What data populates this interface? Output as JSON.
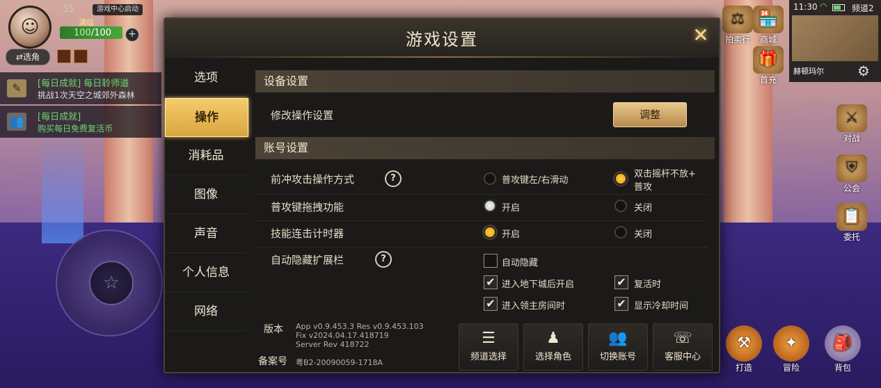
{
  "hud": {
    "level": "55",
    "banner": "游戏中心启动",
    "rank": "满级",
    "stamina_current": "100",
    "stamina_max": "/100",
    "stamina_fraction": 1.0,
    "plus": "+",
    "switch_role": "⇄选角",
    "quests": [
      {
        "title": "[每日成就] 每日聆师道",
        "desc": "挑战1次天空之城郊外森林"
      },
      {
        "title": "[每日成就]",
        "desc": "购买每日免费复活币"
      }
    ]
  },
  "status": {
    "time": "11:30",
    "channel": "频道2",
    "map_name": "赫顿玛尔"
  },
  "right_icons": [
    {
      "label": "拍卖行",
      "icon": "auction-icon"
    },
    {
      "label": "商城",
      "icon": "shop-icon"
    },
    {
      "label": "首充",
      "icon": "first-charge-icon"
    },
    {
      "label": "对战",
      "icon": "battle-icon"
    },
    {
      "label": "公会",
      "icon": "guild-icon"
    },
    {
      "label": "委托",
      "icon": "commission-icon"
    }
  ],
  "bottom_actions": [
    {
      "label": "打造",
      "icon": "forge-icon"
    },
    {
      "label": "冒险",
      "icon": "adventure-icon"
    },
    {
      "label": "背包",
      "icon": "bag-icon"
    }
  ],
  "dialog": {
    "title": "游戏设置",
    "nav": [
      "选项",
      "操作",
      "消耗品",
      "图像",
      "声音",
      "个人信息",
      "网络"
    ],
    "active_nav": "操作",
    "device_section": "设备设置",
    "modify_label": "修改操作设置",
    "adjust_button": "调整",
    "account_section": "账号设置",
    "rows": {
      "dash_attack": {
        "label": "前冲攻击操作方式",
        "opt1": "普攻键左/右滑动",
        "opt2_line1": "双击摇杆不放+",
        "opt2_line2": "普攻"
      },
      "drag": {
        "label": "普攻键拖拽功能",
        "opt1": "开启",
        "opt2": "关闭"
      },
      "combo_timer": {
        "label": "技能连击计时器",
        "opt1": "开启",
        "opt2": "关闭"
      },
      "auto_hide": {
        "label": "自动隐藏扩展栏",
        "opt_auto": "自动隐藏",
        "opt_dungeon": "进入地下城后开启",
        "opt_revive": "复活时",
        "opt_boss": "进入领主房间时",
        "opt_cooldown": "显示冷却时间"
      }
    },
    "footer": {
      "version_label": "版本",
      "version_line1": "App v0.9.453.3 Res v0.9.453.103",
      "version_line2": "Fix v2024.04.17.418719",
      "version_line3": "Server Rev 418722",
      "record_label": "备案号",
      "record_value": "粤B2-20090059-1718A",
      "buttons": [
        {
          "label": "频道选择",
          "icon": "list-icon"
        },
        {
          "label": "选择角色",
          "icon": "character-icon"
        },
        {
          "label": "切换账号",
          "icon": "users-icon"
        },
        {
          "label": "客服中心",
          "icon": "headset-icon"
        }
      ]
    },
    "help_glyph": "?",
    "close_glyph": "✕",
    "check_glyph": "✔"
  }
}
